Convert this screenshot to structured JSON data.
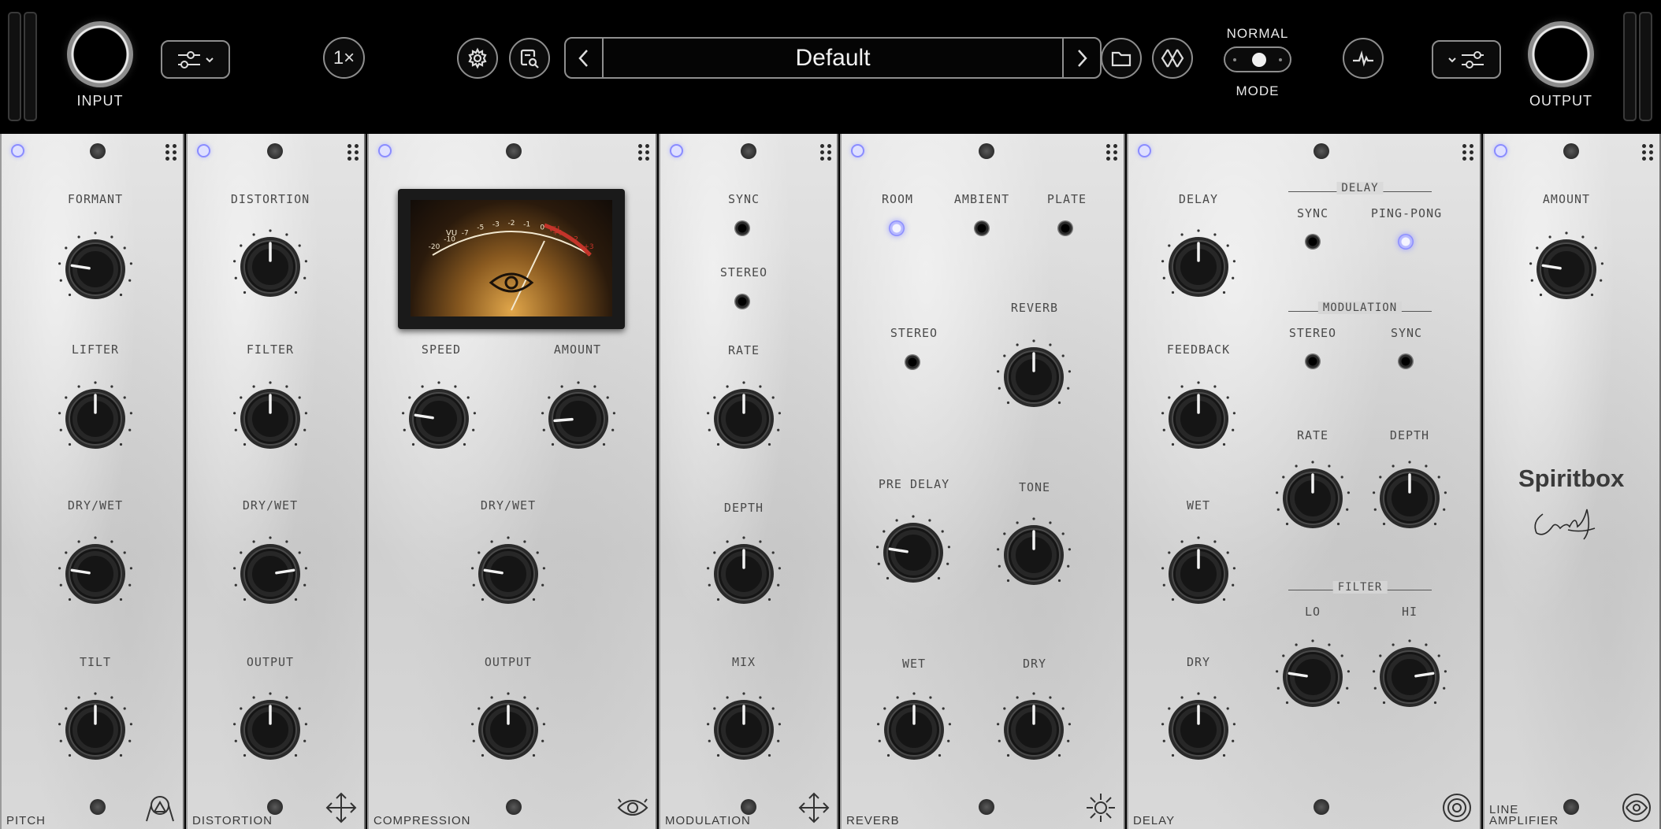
{
  "header": {
    "input_label": "INPUT",
    "output_label": "OUTPUT",
    "oversampling": "1×",
    "preset_name": "Default",
    "mode_top": "NORMAL",
    "mode_bottom": "MODE"
  },
  "modules": {
    "pitch": {
      "name": "PITCH",
      "knobs": [
        "FORMANT",
        "LIFTER",
        "DRY/WET",
        "TILT"
      ]
    },
    "distortion": {
      "name": "DISTORTION",
      "knobs": [
        "DISTORTION",
        "FILTER",
        "DRY/WET",
        "OUTPUT"
      ]
    },
    "compression": {
      "name": "COMPRESSION",
      "knobs": [
        "SPEED",
        "AMOUNT",
        "DRY/WET",
        "OUTPUT"
      ],
      "vu_label": "VU",
      "vu_ticks": [
        "-20",
        "-10",
        "-7",
        "-5",
        "-3",
        "-2",
        "-1",
        "0",
        "+1",
        "+2",
        "+3"
      ]
    },
    "modulation": {
      "name": "MODULATION",
      "switches": [
        "SYNC",
        "STEREO"
      ],
      "knobs": [
        "RATE",
        "DEPTH",
        "MIX"
      ]
    },
    "reverb": {
      "name": "REVERB",
      "types": [
        "ROOM",
        "AMBIENT",
        "PLATE"
      ],
      "stereo": "STEREO",
      "knobs": [
        "REVERB",
        "PRE DELAY",
        "TONE",
        "WET",
        "DRY"
      ]
    },
    "delay": {
      "name": "DELAY",
      "knobs": [
        "DELAY",
        "FEEDBACK",
        "WET",
        "DRY"
      ],
      "delay_section": "DELAY",
      "sync": "SYNC",
      "pingpong": "PING-PONG",
      "mod_section": "MODULATION",
      "mod_stereo": "STEREO",
      "mod_sync": "SYNC",
      "rate": "RATE",
      "depth": "DEPTH",
      "filter_section": "FILTER",
      "lo": "LO",
      "hi": "HI"
    },
    "amp": {
      "name_line1": "LINE",
      "name_line2": "AMPLIFIER",
      "knob": "AMOUNT",
      "brand": "Spiritbox"
    }
  },
  "knob_values": {
    "formant": 0.2,
    "lifter": 0.5,
    "pitch_drywet": 0.2,
    "tilt": 0.5,
    "distortion": 0.5,
    "filter": 0.5,
    "dist_drywet": 0.8,
    "dist_output": 0.5,
    "speed": 0.2,
    "amount": 0.15,
    "comp_drywet": 0.2,
    "comp_output": 0.5,
    "rate": 0.5,
    "depth": 0.5,
    "mix": 0.5,
    "reverb": 0.5,
    "predelay": 0.2,
    "tone": 0.5,
    "wet": 0.5,
    "dry": 0.5,
    "delay": 0.5,
    "feedback": 0.5,
    "delay_wet": 0.5,
    "delay_dry": 0.5,
    "mod_rate": 0.5,
    "mod_depth": 0.5,
    "lo": 0.2,
    "hi": 0.8,
    "amp_amount": 0.2
  },
  "colors": {
    "led": "#8a8cff",
    "panel": "#d8d8d8",
    "header": "#000000"
  }
}
